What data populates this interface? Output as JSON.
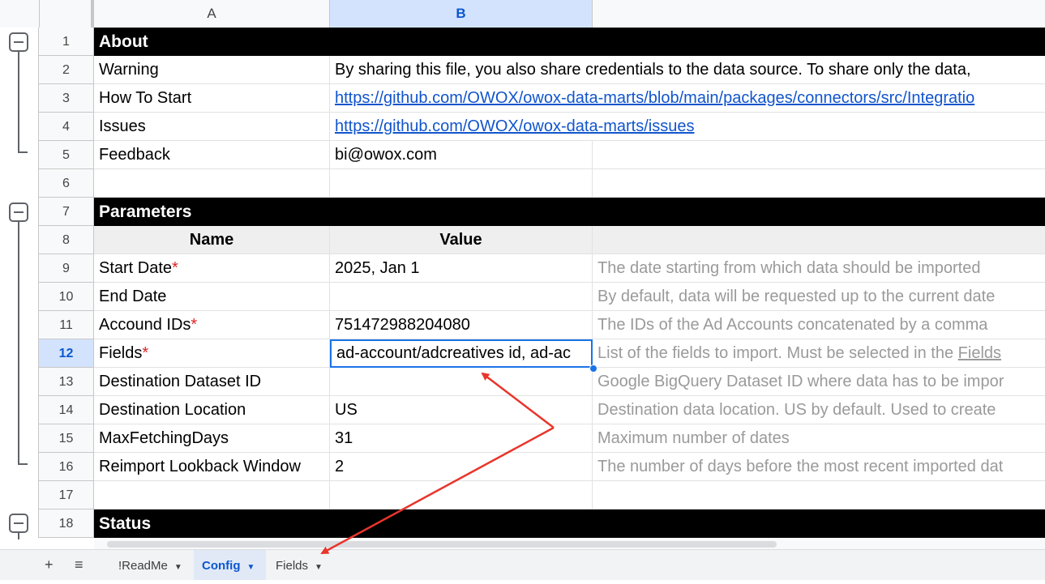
{
  "columns": [
    "A",
    "B"
  ],
  "rows": {
    "r1": {
      "num": "1",
      "section": "About"
    },
    "r2": {
      "num": "2",
      "a": "Warning",
      "b": "By sharing this file, you also share credentials to the data source. To share only the data,"
    },
    "r3": {
      "num": "3",
      "a": "How To Start",
      "b": "https://github.com/OWOX/owox-data-marts/blob/main/packages/connectors/src/Integratio"
    },
    "r4": {
      "num": "4",
      "a": "Issues",
      "b": "https://github.com/OWOX/owox-data-marts/issues"
    },
    "r5": {
      "num": "5",
      "a": "Feedback",
      "b": "bi@owox.com"
    },
    "r6": {
      "num": "6"
    },
    "r7": {
      "num": "7",
      "section": "Parameters"
    },
    "r8": {
      "num": "8",
      "a": "Name",
      "b": "Value"
    },
    "r9": {
      "num": "9",
      "a": "Start Date",
      "b": "2025, Jan 1",
      "c": "The date starting from which data should be imported"
    },
    "r10": {
      "num": "10",
      "a": "End Date",
      "c": "By default, data will be requested up to the current date"
    },
    "r11": {
      "num": "11",
      "a": "Accound IDs",
      "b": "751472988204080",
      "c": "The IDs of the Ad Accounts concatenated by a comma"
    },
    "r12": {
      "num": "12",
      "a": "Fields",
      "b": "ad-account/adcreatives id, ad-ac",
      "c_pre": "List of the fields to import. Must be selected in the ",
      "c_link": "Fields"
    },
    "r13": {
      "num": "13",
      "a": "Destination Dataset ID",
      "c": "Google BigQuery Dataset ID where data has to be impor"
    },
    "r14": {
      "num": "14",
      "a": "Destination Location",
      "b": "US",
      "c": "Destination data location. US by default. Used to create"
    },
    "r15": {
      "num": "15",
      "a": "MaxFetchingDays",
      "b": "31",
      "c": "Maximum number of dates"
    },
    "r16": {
      "num": "16",
      "a": "Reimport Lookback Window",
      "b": "2",
      "c": "The number of days before the most recent imported dat"
    },
    "r17": {
      "num": "17"
    },
    "r18": {
      "num": "18",
      "section": "Status"
    }
  },
  "required_mark": "*",
  "tabs": {
    "add": "+",
    "menu": "≡",
    "items": [
      {
        "label": "!ReadMe",
        "caret": "▼"
      },
      {
        "label": "Config",
        "caret": "▼"
      },
      {
        "label": "Fields",
        "caret": "▼"
      }
    ]
  },
  "colors": {
    "selection": "#1a73e8",
    "section_bg": "#000000",
    "link": "#1155cc",
    "required": "#e02424",
    "annotation_arrow": "#e8352b"
  }
}
